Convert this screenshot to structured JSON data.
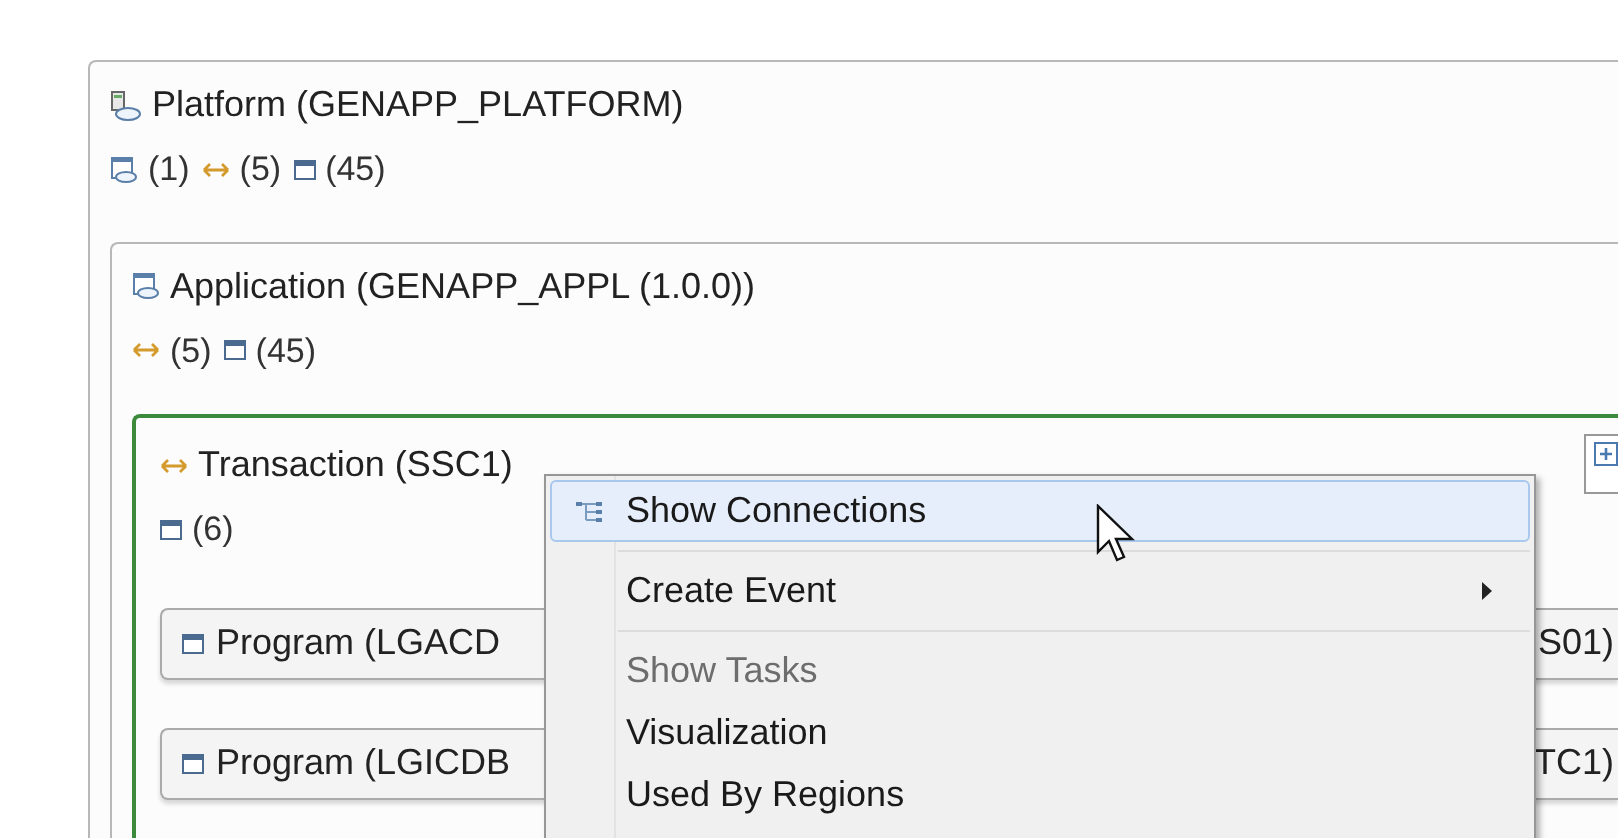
{
  "platform": {
    "title": "Platform (GENAPP_PLATFORM)",
    "counts": [
      {
        "kind": "application",
        "text": "(1)"
      },
      {
        "kind": "transaction",
        "text": "(5)"
      },
      {
        "kind": "program",
        "text": "(45)"
      }
    ],
    "application": {
      "title": "Application (GENAPP_APPL (1.0.0))",
      "counts": [
        {
          "kind": "transaction",
          "text": "(5)"
        },
        {
          "kind": "program",
          "text": "(45)"
        }
      ],
      "transaction": {
        "title": "Transaction (SSC1)",
        "selected": true,
        "counts": [
          {
            "kind": "program",
            "text": "(6)"
          }
        ],
        "programs": [
          {
            "left": "Program (LGACD",
            "right": "S01)"
          },
          {
            "left": "Program (LGICDB",
            "right": "TC1)"
          }
        ]
      }
    }
  },
  "context_menu": {
    "items": [
      {
        "kind": "item",
        "label": "Show Connections",
        "highlighted": true,
        "disabled": false,
        "submenu": false,
        "icon": true
      },
      {
        "kind": "separator"
      },
      {
        "kind": "item",
        "label": "Create Event",
        "highlighted": false,
        "disabled": false,
        "submenu": true,
        "icon": false
      },
      {
        "kind": "separator"
      },
      {
        "kind": "item",
        "label": "Show Tasks",
        "highlighted": false,
        "disabled": true,
        "submenu": false,
        "icon": false
      },
      {
        "kind": "item",
        "label": "Visualization",
        "highlighted": false,
        "disabled": false,
        "submenu": false,
        "icon": false
      },
      {
        "kind": "item",
        "label": "Used By Regions",
        "highlighted": false,
        "disabled": false,
        "submenu": false,
        "icon": false
      }
    ]
  }
}
